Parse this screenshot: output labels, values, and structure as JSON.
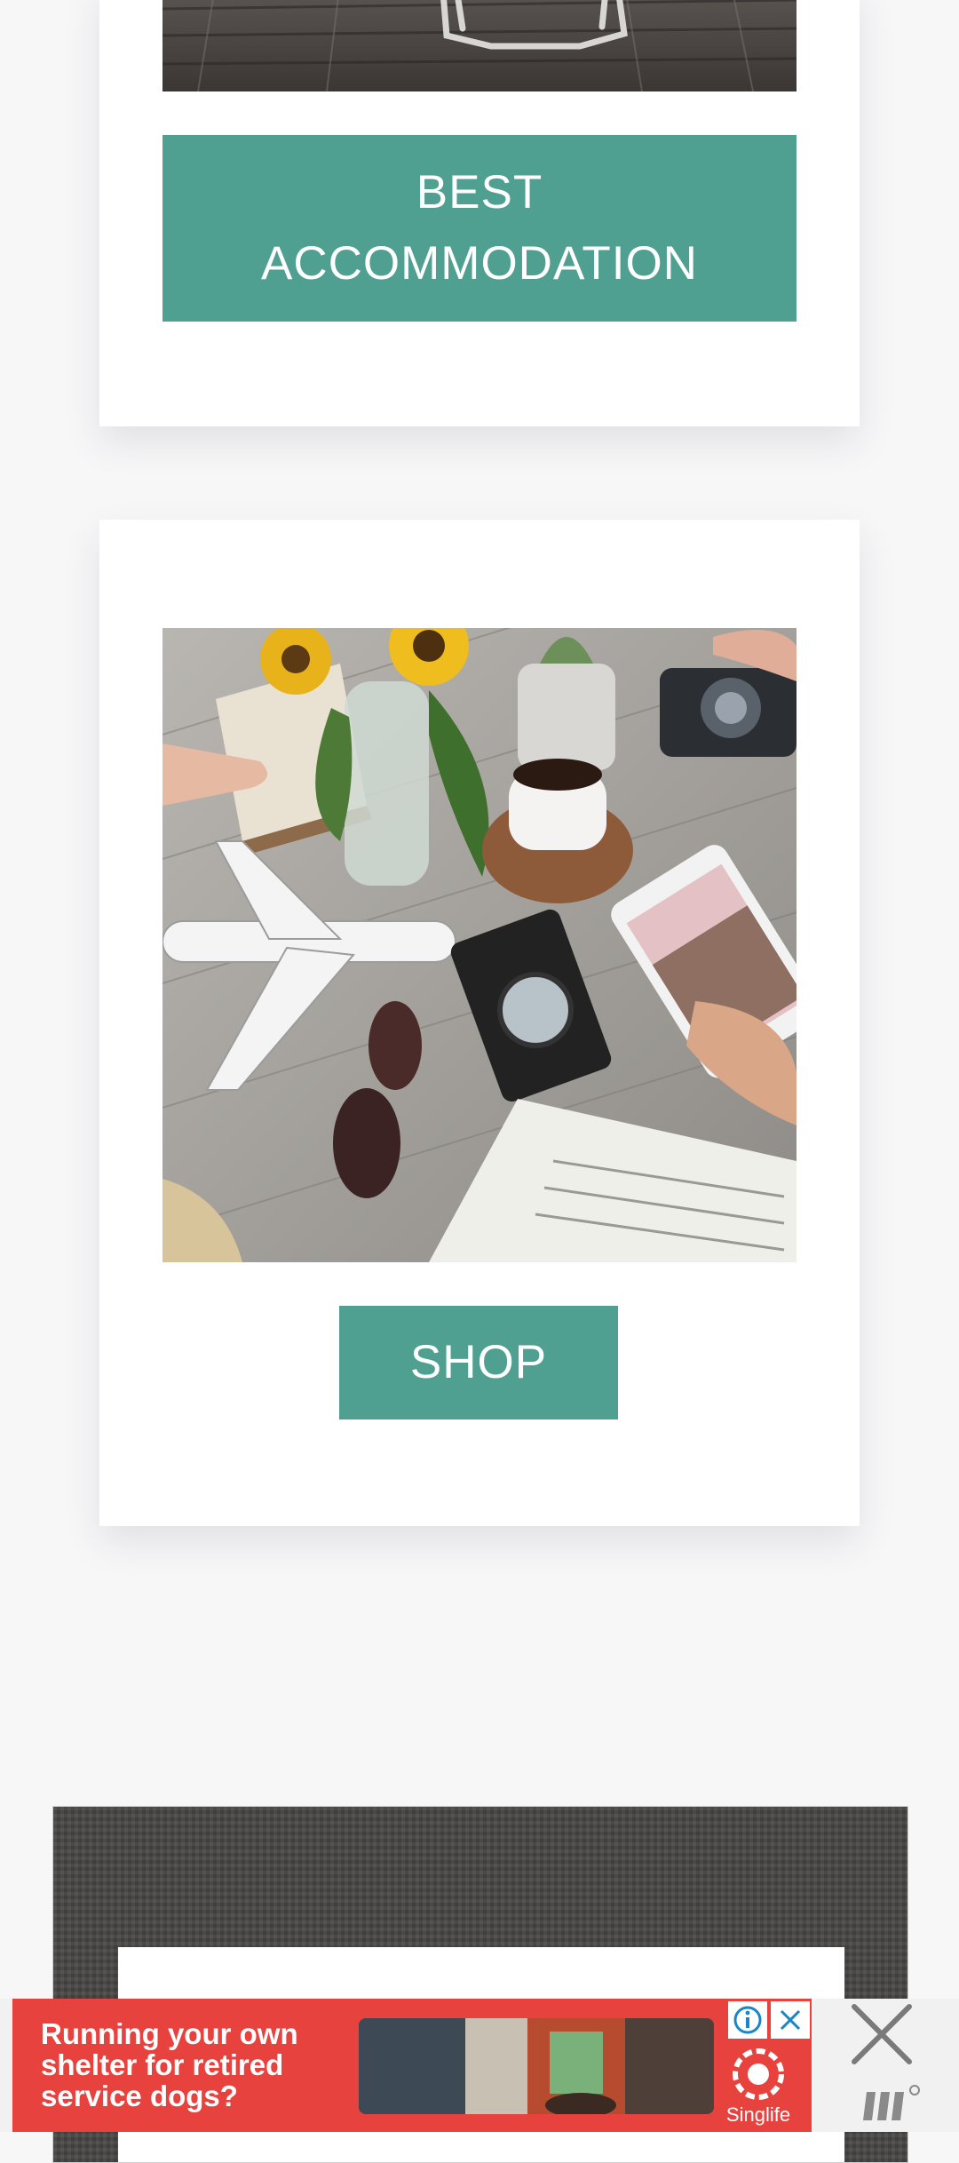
{
  "cards": {
    "accommodation": {
      "button_label": "BEST\nACCOMMODATION"
    },
    "shop": {
      "button_label": "SHOP"
    }
  },
  "ad": {
    "headline": "Running your own shelter for retired service dogs?",
    "brand": "Singlife",
    "info_icon": "info-icon",
    "close_icon": "close-icon"
  },
  "dismiss_icon": "close-icon",
  "ad_network_icon": "ad-network-logo-icon",
  "colors": {
    "accent": "#50a092",
    "ad_background": "#e8423f",
    "page_background": "#f7f7f8"
  }
}
